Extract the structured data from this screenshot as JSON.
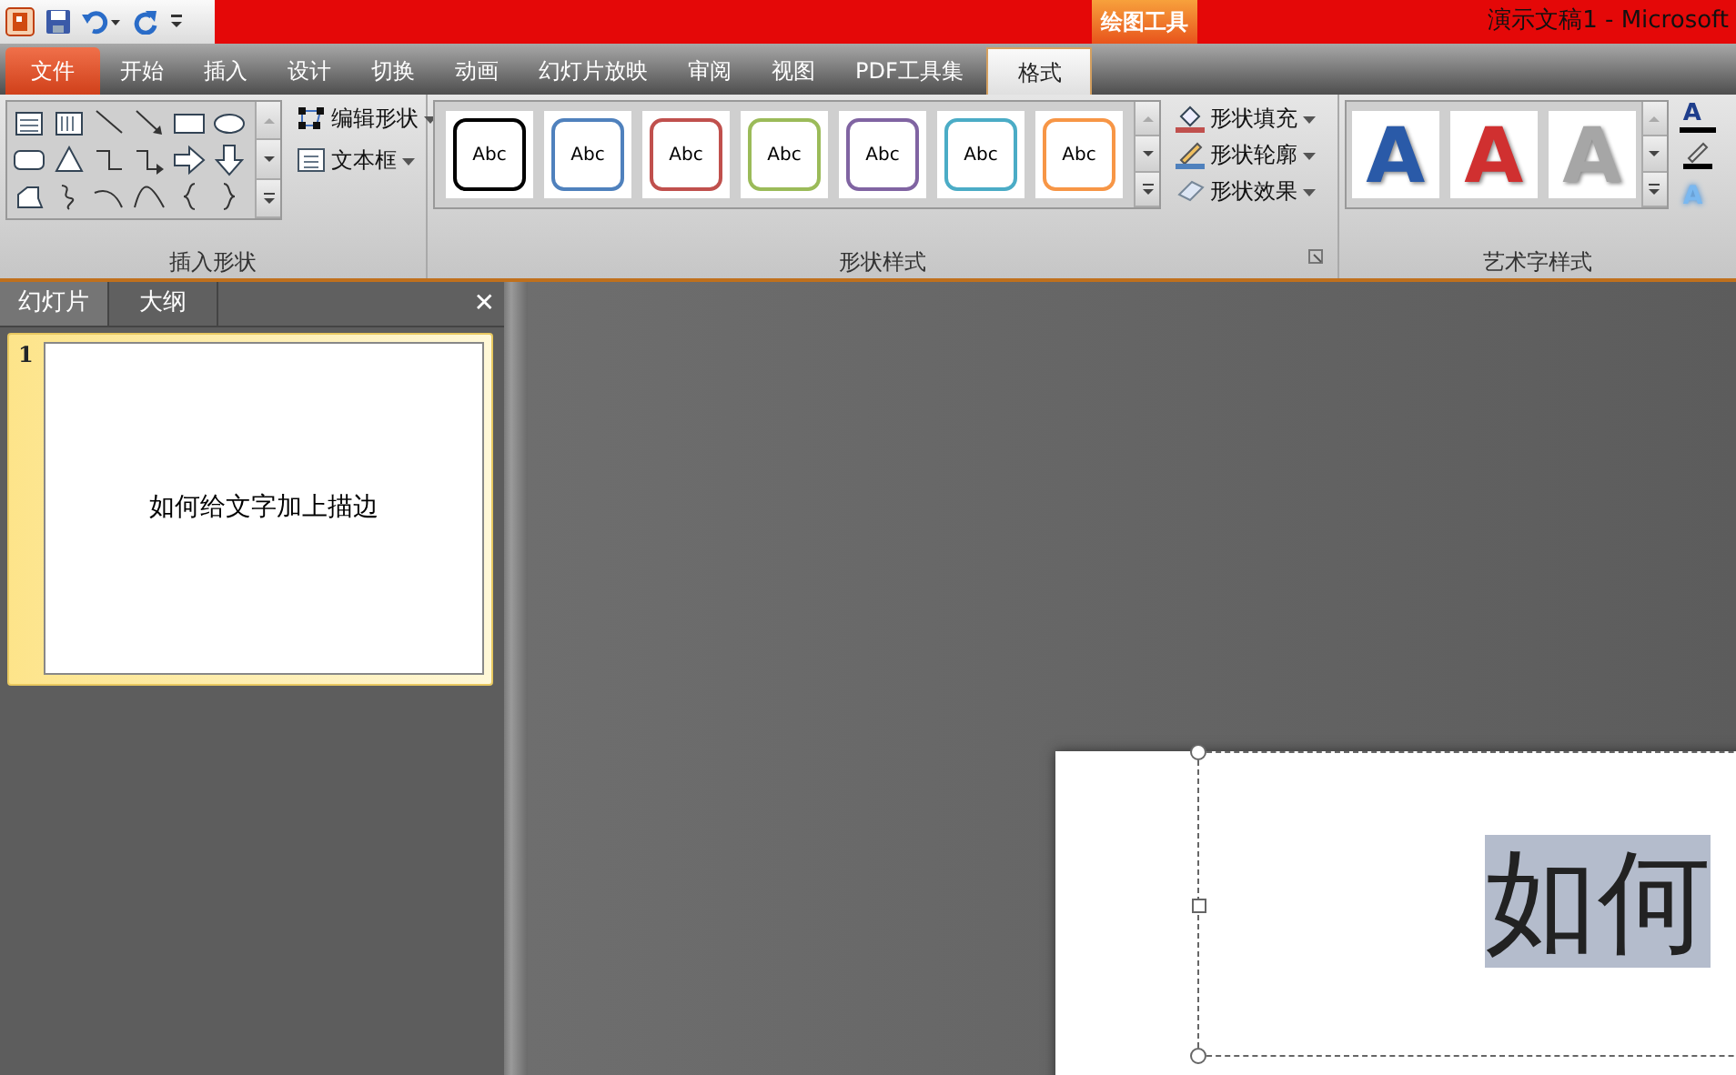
{
  "title_bar": {
    "contextual_tab": "绘图工具",
    "title": "演示文稿1  -  Microsoft"
  },
  "tabs": [
    {
      "label": "文件",
      "kind": "file",
      "selected": false
    },
    {
      "label": "开始",
      "kind": "normal",
      "selected": false
    },
    {
      "label": "插入",
      "kind": "normal",
      "selected": false
    },
    {
      "label": "设计",
      "kind": "normal",
      "selected": false
    },
    {
      "label": "切换",
      "kind": "normal",
      "selected": false
    },
    {
      "label": "动画",
      "kind": "normal",
      "selected": false
    },
    {
      "label": "幻灯片放映",
      "kind": "normal",
      "selected": false
    },
    {
      "label": "审阅",
      "kind": "normal",
      "selected": false
    },
    {
      "label": "视图",
      "kind": "normal",
      "selected": false
    },
    {
      "label": "PDF工具集",
      "kind": "normal",
      "selected": false
    },
    {
      "label": "格式",
      "kind": "contextual",
      "selected": true
    }
  ],
  "ribbon": {
    "insert_shapes": {
      "label": "插入形状",
      "buttons": [
        {
          "label": "编辑形状",
          "kind": "edit"
        },
        {
          "label": "文本框",
          "kind": "textbox"
        }
      ]
    },
    "shape_styles": {
      "label": "形状样式",
      "gallery": [
        {
          "text": "Abc",
          "color": "#000000"
        },
        {
          "text": "Abc",
          "color": "#4f81bd"
        },
        {
          "text": "Abc",
          "color": "#c0504d"
        },
        {
          "text": "Abc",
          "color": "#9bbb59"
        },
        {
          "text": "Abc",
          "color": "#8064a2"
        },
        {
          "text": "Abc",
          "color": "#4bacc6"
        },
        {
          "text": "Abc",
          "color": "#f79646"
        }
      ],
      "buttons": [
        {
          "label": "形状填充",
          "kind": "fill"
        },
        {
          "label": "形状轮廓",
          "kind": "outline"
        },
        {
          "label": "形状效果",
          "kind": "effects"
        }
      ]
    },
    "wordart_styles": {
      "label": "艺术字样式",
      "gallery": [
        {
          "text": "A",
          "color": "#2a5aa8"
        },
        {
          "text": "A",
          "color": "#d03030"
        },
        {
          "text": "A",
          "color": "#a6a6a6"
        }
      ],
      "tools": [
        {
          "kind": "fill",
          "text": "A"
        },
        {
          "kind": "outline"
        },
        {
          "kind": "effects",
          "text": "A"
        }
      ]
    }
  },
  "pane": {
    "tabs": [
      {
        "label": "幻灯片",
        "selected": true
      },
      {
        "label": "大纲",
        "selected": false
      }
    ],
    "close": "✕",
    "slides": [
      {
        "number": "1",
        "title": "如何给文字加上描边",
        "selected": true
      }
    ]
  },
  "slide": {
    "text": "如何",
    "selected": true
  }
}
